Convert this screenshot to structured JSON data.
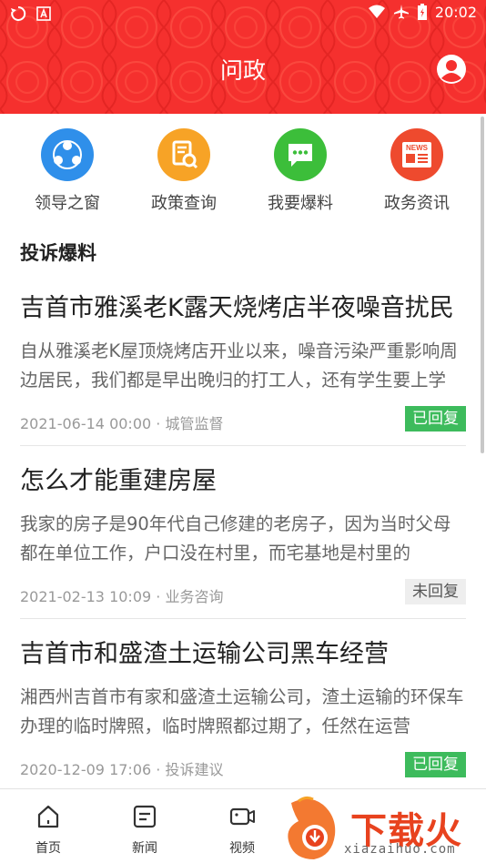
{
  "status_bar": {
    "time": "20:02"
  },
  "header": {
    "title": "问政"
  },
  "quick_nav": [
    {
      "label": "领导之窗",
      "icon": "people-group-icon",
      "color": "#2f8fea"
    },
    {
      "label": "政策查询",
      "icon": "document-search-icon",
      "color": "#f7a326"
    },
    {
      "label": "我要爆料",
      "icon": "chat-bubble-icon",
      "color": "#3cbe3a"
    },
    {
      "label": "政务资讯",
      "icon": "newspaper-icon",
      "color": "#ee4a2e"
    }
  ],
  "news_badge_text": "NEWS",
  "section": {
    "title": "投诉爆料"
  },
  "complaints": [
    {
      "title": "吉首市雅溪老K露天烧烤店半夜噪音扰民",
      "body": "自从雅溪老K屋顶烧烤店开业以来，噪音污染严重影响周边居民，我们都是早出晚归的打工人，还有学生要上学",
      "date": "2021-06-14 00:00",
      "category": "城管监督",
      "status": "已回复",
      "replied": true
    },
    {
      "title": "怎么才能重建房屋",
      "body": "我家的房子是90年代自己修建的老房子，因为当时父母都在单位工作，户口没在村里，而宅基地是村里的",
      "date": "2021-02-13 10:09",
      "category": "业务咨询",
      "status": "未回复",
      "replied": false
    },
    {
      "title": "吉首市和盛渣土运输公司黑车经营",
      "body": "湘西州吉首市有家和盛渣土运输公司，渣土运输的环保车办理的临时牌照，临时牌照都过期了，任然在运营",
      "date": "2020-12-09 17:06",
      "category": "投诉建议",
      "status": "已回复",
      "replied": true
    }
  ],
  "bottom_nav": [
    {
      "label": "首页",
      "icon": "home-icon"
    },
    {
      "label": "新闻",
      "icon": "news-icon"
    },
    {
      "label": "视频",
      "icon": "video-icon"
    }
  ],
  "watermark": {
    "text": "下载火",
    "sub": "xiazaihuo.com"
  },
  "colors": {
    "brand_red": "#f5302e",
    "replied_green": "#3dbb5c"
  }
}
